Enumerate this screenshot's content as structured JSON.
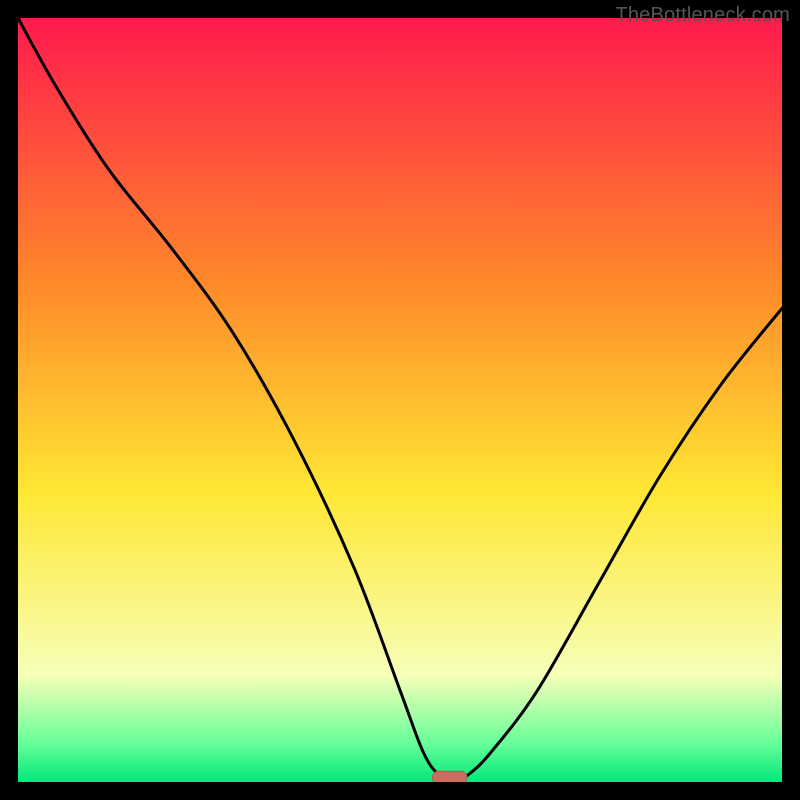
{
  "watermark": "TheBottleneck.com",
  "colors": {
    "bg": "#000000",
    "grad_top": "#ff1a4d",
    "grad_mid1": "#ff8a2a",
    "grad_mid2": "#ffe733",
    "grad_low1": "#f7ffb8",
    "grad_low2": "#66ff99",
    "grad_bottom": "#00e87a",
    "curve": "#000000",
    "marker_fill": "#cc6b60",
    "marker_stroke": "#bf5a50"
  },
  "chart_data": {
    "type": "line",
    "title": "",
    "xlabel": "",
    "ylabel": "",
    "xlim": [
      0,
      100
    ],
    "ylim": [
      0,
      100
    ],
    "series": [
      {
        "name": "bottleneck-curve",
        "x": [
          0,
          5,
          12,
          20,
          28,
          36,
          44,
          50,
          53,
          55,
          57,
          59,
          62,
          68,
          76,
          84,
          92,
          100
        ],
        "y": [
          100,
          91,
          80,
          70,
          59,
          45,
          28,
          12,
          4,
          1,
          0,
          1,
          4,
          12,
          26,
          40,
          52,
          62
        ]
      }
    ],
    "marker": {
      "x": 56.5,
      "y": 0.6,
      "w": 4.5,
      "h": 1.6
    },
    "background_gradient_stops": [
      {
        "offset": 0.0,
        "color_key": "grad_top"
      },
      {
        "offset": 0.35,
        "color_key": "grad_mid1"
      },
      {
        "offset": 0.62,
        "color_key": "grad_mid2"
      },
      {
        "offset": 0.86,
        "color_key": "grad_low1"
      },
      {
        "offset": 0.95,
        "color_key": "grad_low2"
      },
      {
        "offset": 1.0,
        "color_key": "grad_bottom"
      }
    ]
  }
}
